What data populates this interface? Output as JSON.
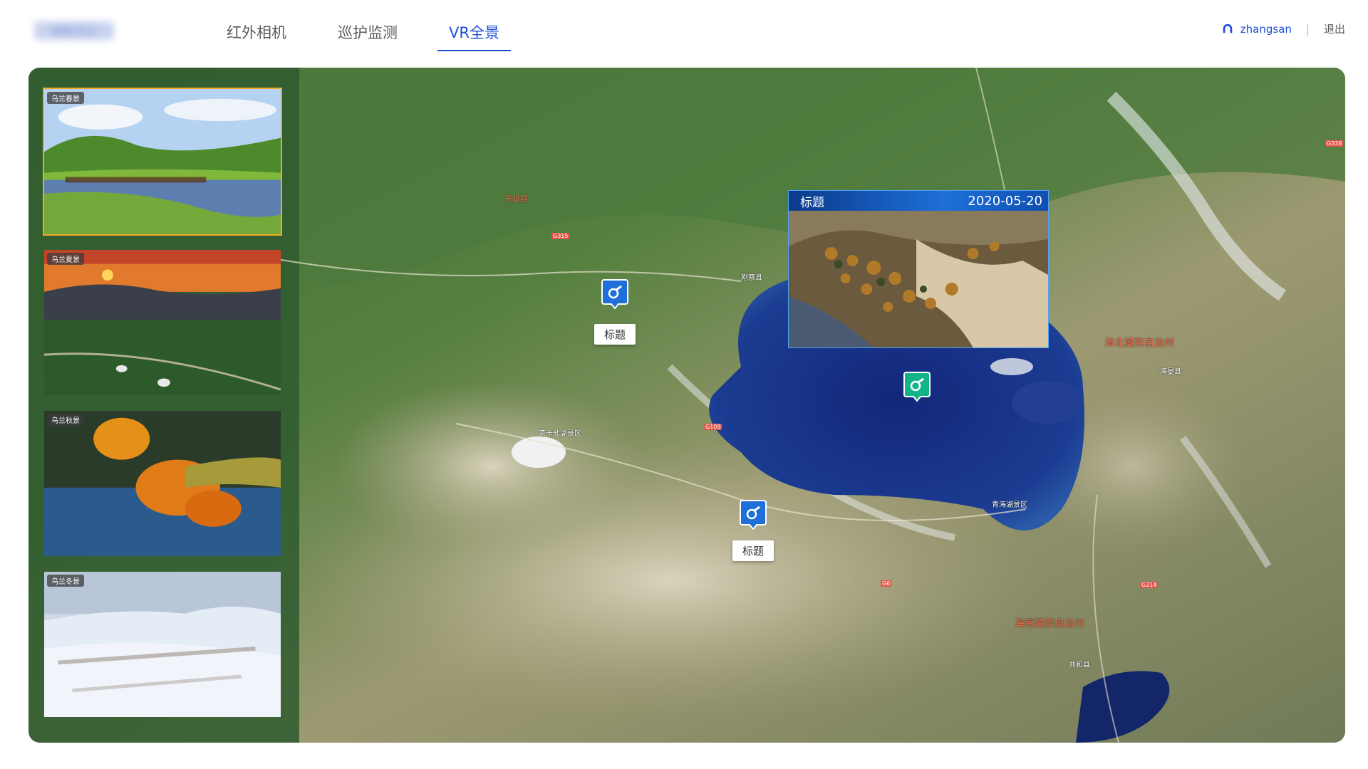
{
  "header": {
    "logo_text": "绿色乌兰",
    "tabs": [
      {
        "label": "红外相机",
        "active": false
      },
      {
        "label": "巡护监测",
        "active": false
      },
      {
        "label": "VR全景",
        "active": true
      }
    ],
    "user": {
      "name": "zhangsan",
      "separator": "|",
      "logout": "退出"
    },
    "accent_color": "#1d4fd6"
  },
  "thumbnails": [
    {
      "label": "乌兰春景",
      "selected": true
    },
    {
      "label": "乌兰夏景",
      "selected": false
    },
    {
      "label": "乌兰秋景",
      "selected": false
    },
    {
      "label": "乌兰冬景",
      "selected": false
    }
  ],
  "map": {
    "labels": {
      "l1": "天峻县",
      "l2": "海北藏族自治州",
      "l3": "海南藏族自治州",
      "l4": "青海湖景区",
      "l5": "茶卡盐湖景区",
      "l6": "海晏县",
      "l7": "刚察县",
      "l8": "共和县",
      "l9": "G315",
      "l10": "G109",
      "l11": "G6",
      "l12": "G214",
      "l13": "G338"
    },
    "markers": [
      {
        "tag": "标题",
        "color": "#1e6fd9",
        "icon": "camera-icon"
      },
      {
        "tag": "标题",
        "color": "#1e6fd9",
        "icon": "camera-icon"
      },
      {
        "tag": "",
        "color": "#14b38a",
        "icon": "camera-icon"
      }
    ],
    "popup": {
      "title": "标题",
      "date": "2020-05-20"
    }
  }
}
